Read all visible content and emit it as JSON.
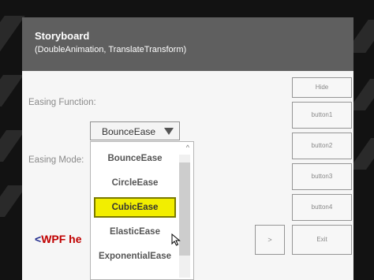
{
  "window": {
    "title": "Storyboard",
    "subtitle": "(DoubleAnimation, TranslateTransform)"
  },
  "form": {
    "easing_function_label": "Easing Function:",
    "easing_mode_label": "Easing Mode:",
    "combo_value": "BounceEase"
  },
  "dropdown": {
    "scroll_up_glyph": "^",
    "items": [
      {
        "label": "BounceEase"
      },
      {
        "label": "CircleEase"
      },
      {
        "label": "CubicEase"
      },
      {
        "label": "ElasticEase"
      },
      {
        "label": "ExponentialEase"
      }
    ],
    "selected_index": 2
  },
  "buttons": {
    "hide": "Hide",
    "button1": "button1",
    "button2": "button2",
    "button3": "button3",
    "button4": "button4",
    "next": ">",
    "exit": "Exit"
  },
  "overlay": {
    "lt": "<",
    "text": "WPF he"
  },
  "colors": {
    "titlebar": "#5f5f5f",
    "selected_highlight": "#f2ee00",
    "overlay_text": "#c00000",
    "overlay_lt": "#1f2a8c"
  }
}
